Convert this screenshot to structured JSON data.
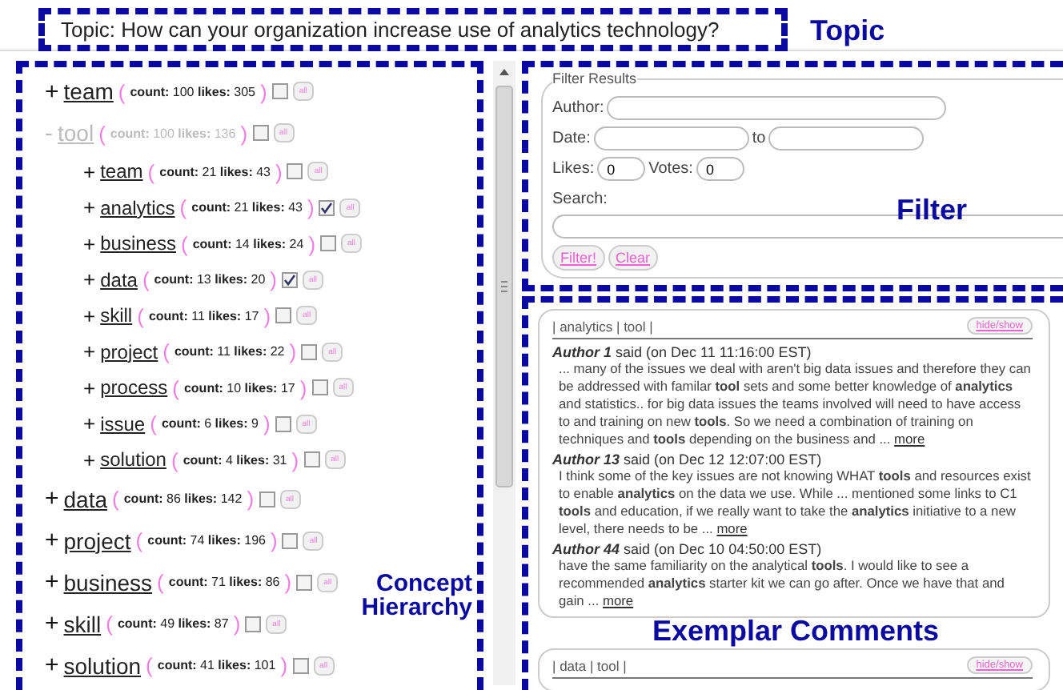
{
  "topic": {
    "text": "Topic: How can your organization increase use of analytics technology?",
    "annotation": "Topic"
  },
  "tree": {
    "annotation": [
      "Concept",
      "Hierarchy"
    ],
    "nodes": [
      {
        "toggle": "+",
        "label": "team",
        "open": "(",
        "stats": "**count:** 100 **likes:** 305",
        "close": ")",
        "checked": false,
        "button": "all",
        "expanded": false
      },
      {
        "toggle": "-",
        "label": "tool",
        "open": "(",
        "stats": "**count:** 100 **likes:** 136",
        "close": ")",
        "checked": false,
        "button": "all",
        "expanded": true,
        "children": [
          {
            "toggle": "+",
            "label": "team",
            "open": "(",
            "stats": "**count:** 21 **likes:** 43",
            "close": ")",
            "checked": false,
            "button": "all",
            "expanded": false
          },
          {
            "toggle": "+",
            "label": "analytics",
            "open": "(",
            "stats": "**count:** 21 **likes:** 43",
            "close": ")",
            "checked": true,
            "button": "all",
            "expanded": false
          },
          {
            "toggle": "+",
            "label": "business",
            "open": "(",
            "stats": "**count:** 14 **likes:** 24",
            "close": ")",
            "checked": false,
            "button": "all",
            "expanded": false
          },
          {
            "toggle": "+",
            "label": "data",
            "open": "(",
            "stats": "**count:** 13 **likes:** 20",
            "close": ")",
            "checked": true,
            "button": "all",
            "expanded": false
          },
          {
            "toggle": "+",
            "label": "skill",
            "open": "(",
            "stats": "**count:** 11 **likes:** 17",
            "close": ")",
            "checked": false,
            "button": "all",
            "expanded": false
          },
          {
            "toggle": "+",
            "label": "project",
            "open": "(",
            "stats": "**count:** 11 **likes:** 22",
            "close": ")",
            "checked": false,
            "button": "all",
            "expanded": false
          },
          {
            "toggle": "+",
            "label": "process",
            "open": "(",
            "stats": "**count:** 10 **likes:** 17",
            "close": ")",
            "checked": false,
            "button": "all",
            "expanded": false
          },
          {
            "toggle": "+",
            "label": "issue",
            "open": "(",
            "stats": "**count:** 6 **likes:** 9",
            "close": ")",
            "checked": false,
            "button": "all",
            "expanded": false
          },
          {
            "toggle": "+",
            "label": "solution",
            "open": "(",
            "stats": "**count:** 4 **likes:** 31",
            "close": ")",
            "checked": false,
            "button": "all",
            "expanded": false
          }
        ]
      },
      {
        "toggle": "+",
        "label": "data",
        "open": "(",
        "stats": "**count:** 86 **likes:** 142",
        "close": ")",
        "checked": false,
        "button": "all",
        "expanded": false
      },
      {
        "toggle": "+",
        "label": "project",
        "open": "(",
        "stats": "**count:** 74 **likes:** 196",
        "close": ")",
        "checked": false,
        "button": "all",
        "expanded": false
      },
      {
        "toggle": "+",
        "label": "business",
        "open": "(",
        "stats": "**count:** 71 **likes:** 86",
        "close": ")",
        "checked": false,
        "button": "all",
        "expanded": false
      },
      {
        "toggle": "+",
        "label": "skill",
        "open": "(",
        "stats": "**count:** 49 **likes:** 87",
        "close": ")",
        "checked": false,
        "button": "all",
        "expanded": false
      },
      {
        "toggle": "+",
        "label": "solution",
        "open": "(",
        "stats": "**count:** 41 **likes:** 101",
        "close": ")",
        "checked": false,
        "button": "all",
        "expanded": false
      }
    ]
  },
  "filter": {
    "legend": "Filter Results",
    "annotation": "Filter",
    "author": {
      "label": "Author:"
    },
    "date": {
      "label": "Date:",
      "separator": "to"
    },
    "likes": {
      "label": "Likes:",
      "value": "0"
    },
    "votes": {
      "label": "Votes:",
      "value": "0"
    },
    "search": {
      "label": "Search:"
    },
    "buttons": [
      "Filter!",
      "Clear"
    ]
  },
  "comments": {
    "annotation": "Exemplar Comments",
    "groups": [
      {
        "tags": "| analytics | tool |",
        "toggle": "hide/show",
        "items": [
          {
            "author": "Author 1",
            "meta": "said (on Dec 11 11:16:00 EST)",
            "body": "... many of the issues we deal with aren't big data issues and therefore they can be addressed with familar **tool** sets and some better knowledge of **analytics** and statistics..  for big data issues the teams involved will need to have access to and training on new **tools**.  So we need a combination of training on techniques and **tools** depending on the business and ...",
            "more": "more"
          },
          {
            "author": "Author 13",
            "meta": "said (on Dec 12 12:07:00 EST)",
            "body": "I think some of the key issues are not knowing WHAT **tools** and resources exist to enable **analytics** on the data we use. While ... mentioned some links to C1 **tools** and education, if we really want to take the **analytics** initiative to a new level, there needs to be ...",
            "more": "more"
          },
          {
            "author": "Author 44",
            "meta": "said (on Dec 10 04:50:00 EST)",
            "body": "have the same familiarity on the analytical **tools**. I would like to see a recommended **analytics** starter kit we can go after. Once we have that and gain ...",
            "more": "more"
          }
        ]
      },
      {
        "tags": "| data | tool |",
        "toggle": "hide/show"
      }
    ]
  }
}
